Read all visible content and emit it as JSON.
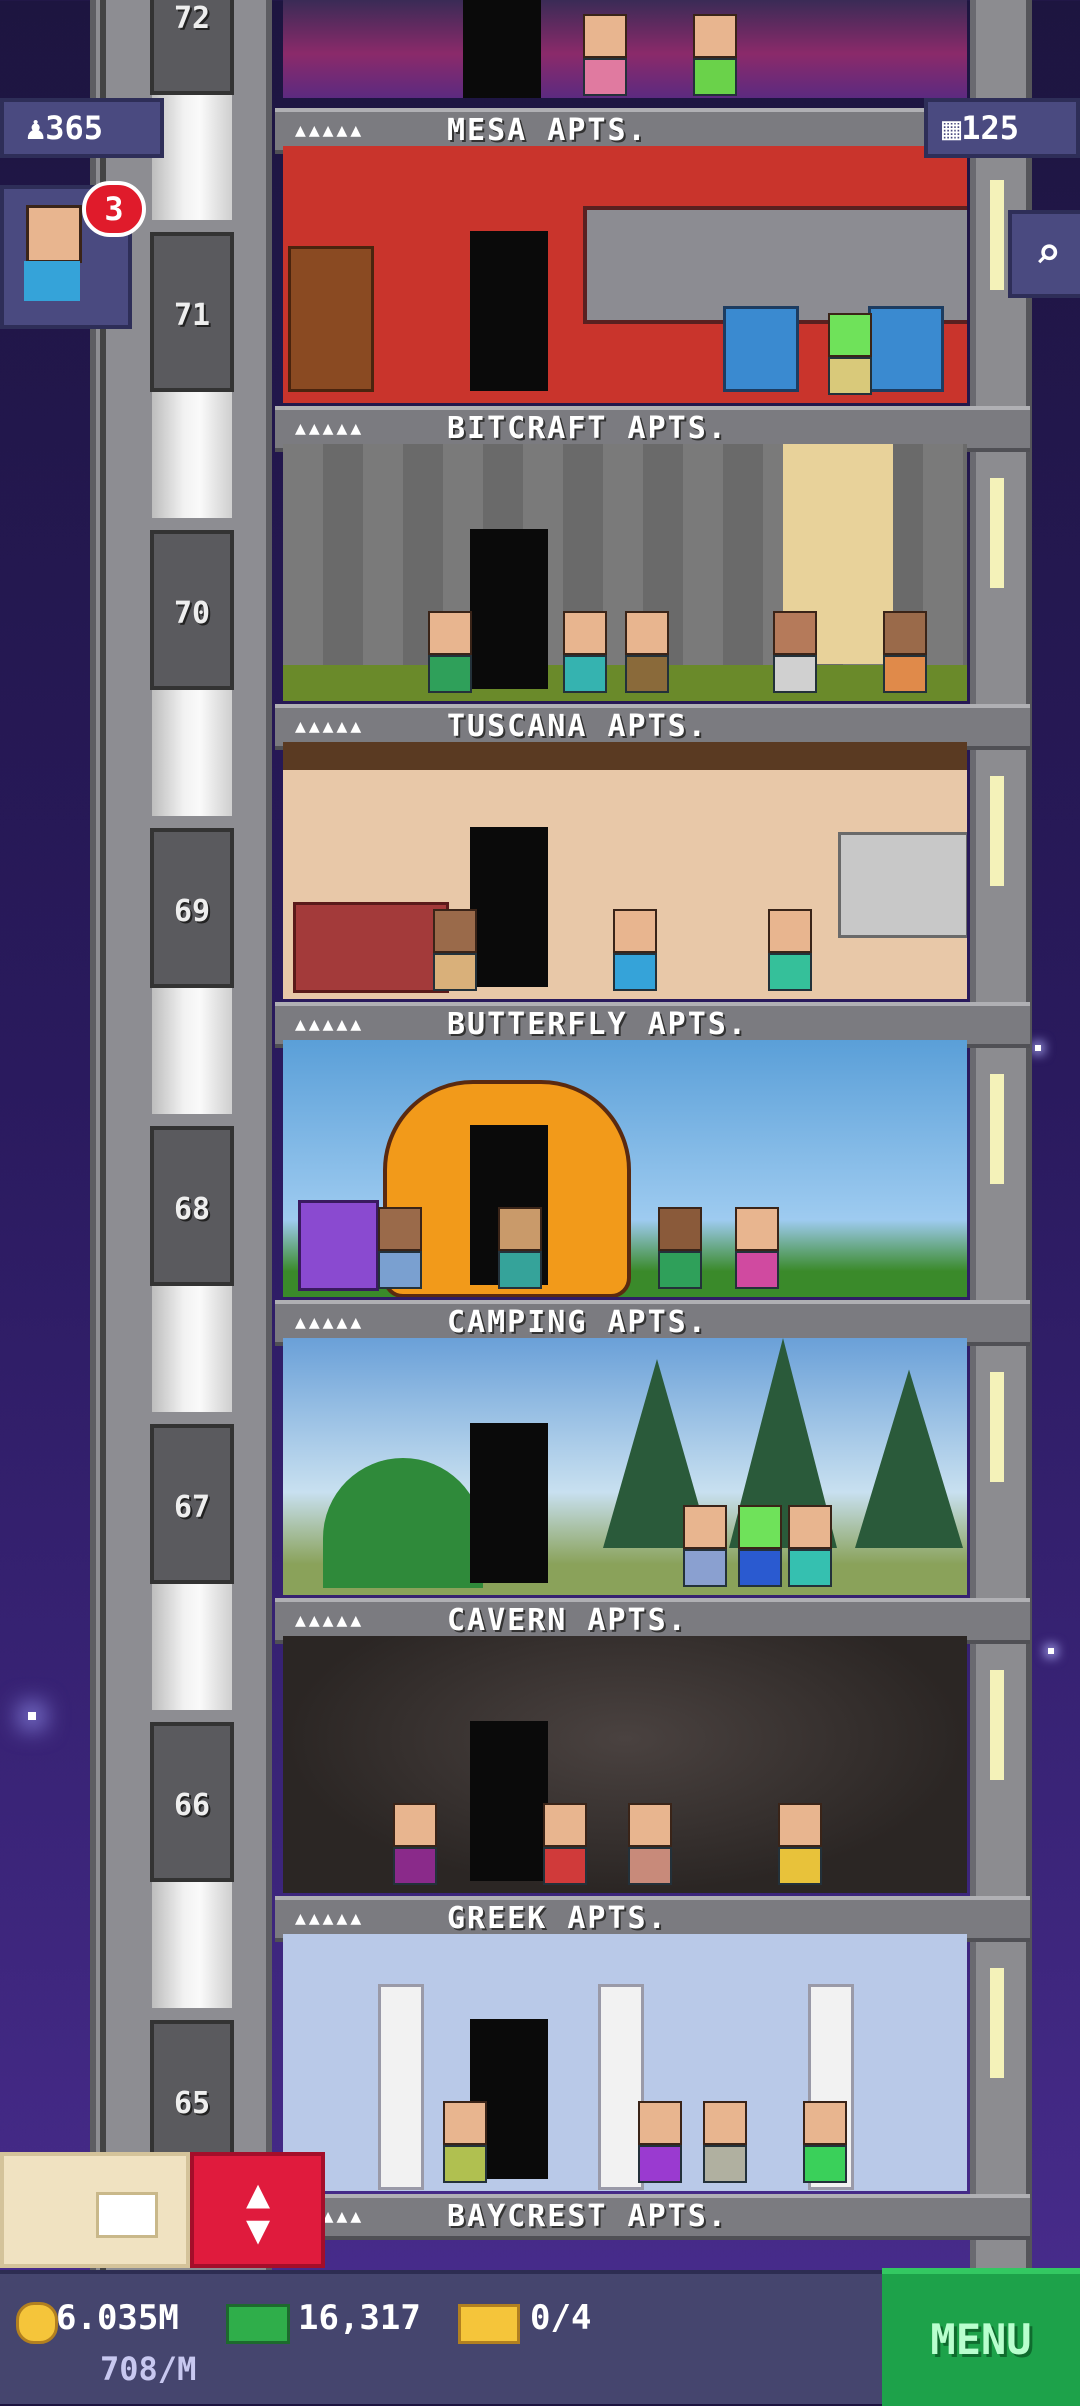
{
  "hud": {
    "population": "365",
    "floors_count": "125",
    "notification_count": "3",
    "coins": "6.035M",
    "coin_rate": "708/M",
    "bux": "16,317",
    "tickets": "0/4",
    "menu_label": "MENU"
  },
  "floors": [
    {
      "number": "72",
      "name": "MESA APTS."
    },
    {
      "number": "71",
      "name": "BITCRAFT APTS."
    },
    {
      "number": "70",
      "name": "TUSCANA APTS."
    },
    {
      "number": "69",
      "name": "BUTTERFLY APTS."
    },
    {
      "number": "68",
      "name": "CAMPING APTS."
    },
    {
      "number": "67",
      "name": "CAVERN APTS."
    },
    {
      "number": "66",
      "name": "GREEK APTS."
    },
    {
      "number": "65",
      "name": "BAYCREST APTS."
    }
  ],
  "colors": {
    "mesa": "#c9342c",
    "bitcraft": "#7a7a7a",
    "tuscana": "#e8c8a8",
    "butterfly": "#5a9fd8",
    "camping": "#9ec8e8",
    "cavern": "#2b2624",
    "greek": "#b9c9e8",
    "menu_green": "#1da24a",
    "elevator_red": "#e01b3d"
  }
}
